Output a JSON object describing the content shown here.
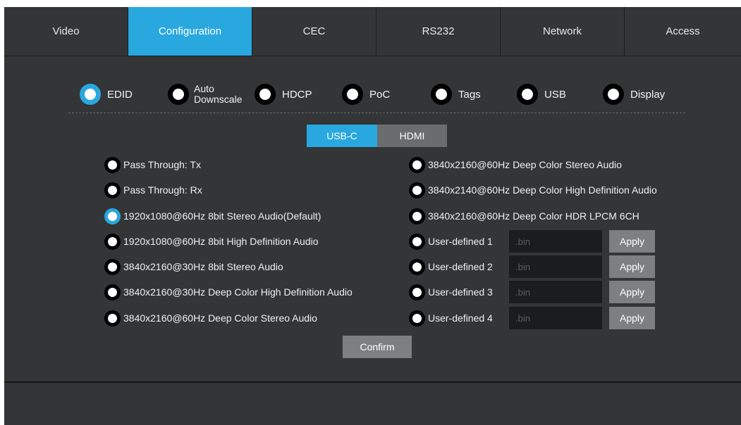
{
  "tabs": [
    {
      "label": "Video",
      "active": false
    },
    {
      "label": "Configuration",
      "active": true
    },
    {
      "label": "CEC",
      "active": false
    },
    {
      "label": "RS232",
      "active": false
    },
    {
      "label": "Network",
      "active": false
    },
    {
      "label": "Access",
      "active": false
    }
  ],
  "subtabs": {
    "edid": "EDID",
    "downscale_line1": "Auto",
    "downscale_line2": "Downscale",
    "hdcp": "HDCP",
    "poc": "PoC",
    "tags": "Tags",
    "usb": "USB",
    "display": "Display",
    "selected": "EDID"
  },
  "ports": {
    "usbc": "USB-C",
    "hdmi": "HDMI",
    "selected": "USB-C"
  },
  "left_options": [
    {
      "label": "Pass Through: Tx",
      "checked": false
    },
    {
      "label": "Pass Through: Rx",
      "checked": false
    },
    {
      "label": "1920x1080@60Hz 8bit Stereo Audio(Default)",
      "checked": true
    },
    {
      "label": "1920x1080@60Hz 8bit High Definition Audio",
      "checked": false
    },
    {
      "label": "3840x2160@30Hz 8bit Stereo Audio",
      "checked": false
    },
    {
      "label": "3840x2160@30Hz Deep Color High Definition Audio",
      "checked": false
    },
    {
      "label": "3840x2160@60Hz Deep Color Stereo Audio",
      "checked": false
    }
  ],
  "right_options": [
    {
      "label": "3840x2160@60Hz Deep Color Stereo Audio",
      "checked": false
    },
    {
      "label": "3840x2140@60Hz Deep Color High Definition Audio",
      "checked": false
    },
    {
      "label": "3840x2160@60Hz Deep Color HDR LPCM 6CH",
      "checked": false
    }
  ],
  "user_defined": [
    {
      "label": "User-defined 1",
      "file_placeholder": ".bin",
      "button": "Apply"
    },
    {
      "label": "User-defined 2",
      "file_placeholder": ".bin",
      "button": "Apply"
    },
    {
      "label": "User-defined 3",
      "file_placeholder": ".bin",
      "button": "Apply"
    },
    {
      "label": "User-defined 4",
      "file_placeholder": ".bin",
      "button": "Apply"
    }
  ],
  "confirm_label": "Confirm",
  "colors": {
    "accent": "#29a7df",
    "background": "#333537",
    "button": "#7d7f81",
    "input": "#1b1c1d"
  }
}
